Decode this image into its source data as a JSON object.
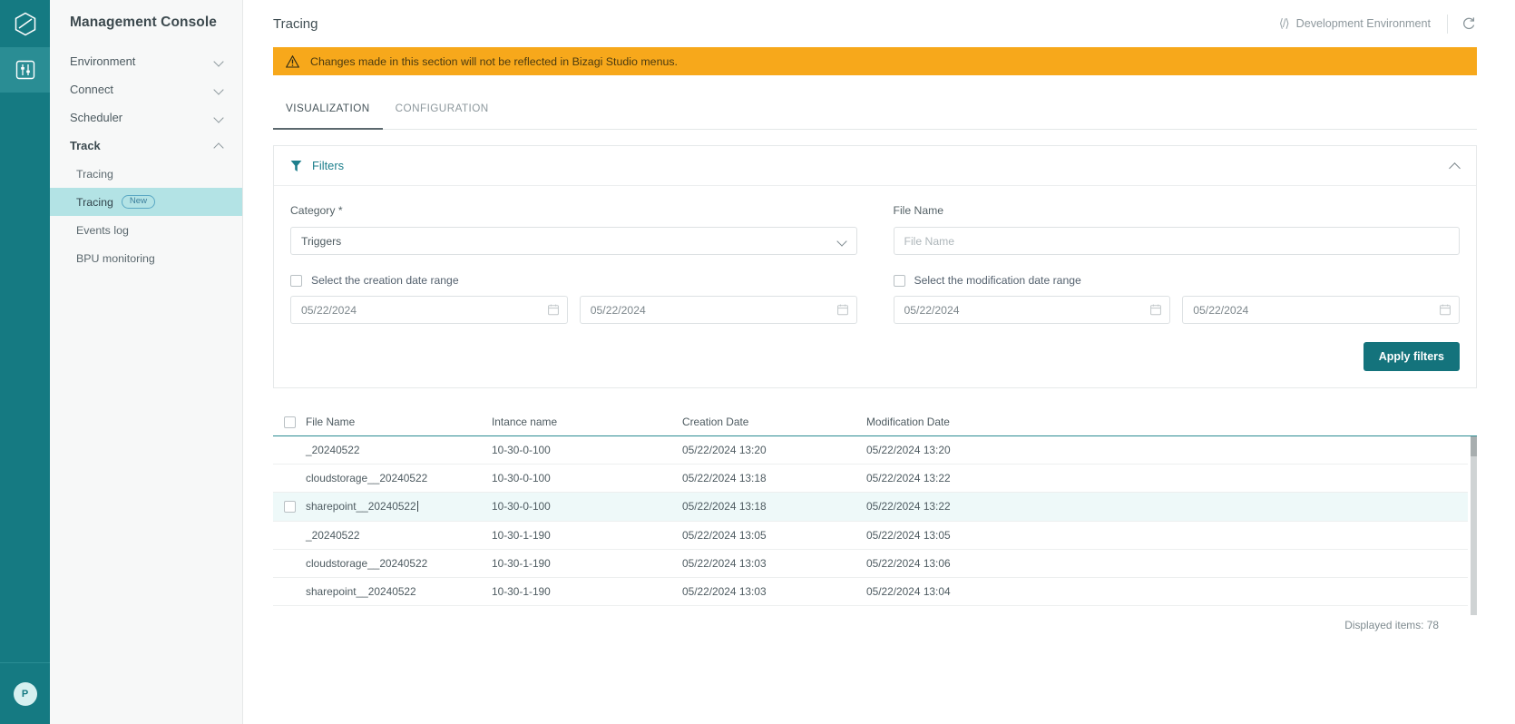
{
  "rail": {
    "logo_icon": "hexagon-logo-icon",
    "items": [
      {
        "icon": "sliders-settings-icon",
        "name": "management-console-icon",
        "active": true
      }
    ],
    "avatar_initial": "P"
  },
  "sidebar": {
    "title": "Management Console",
    "groups": [
      {
        "label": "Environment",
        "state": "collapsed"
      },
      {
        "label": "Connect",
        "state": "collapsed"
      },
      {
        "label": "Scheduler",
        "state": "collapsed"
      },
      {
        "label": "Track",
        "state": "expanded"
      }
    ],
    "track_children": [
      {
        "label": "Tracing",
        "selected": false,
        "badge": ""
      },
      {
        "label": "Tracing",
        "selected": true,
        "badge": "New"
      },
      {
        "label": "Events log",
        "selected": false,
        "badge": ""
      },
      {
        "label": "BPU monitoring",
        "selected": false,
        "badge": ""
      }
    ]
  },
  "header": {
    "title": "Tracing",
    "code_icon": "code-brackets-icon",
    "environment": "Development Environment",
    "refresh_icon": "refresh-icon"
  },
  "banner": {
    "icon": "warning-triangle-icon",
    "text": "Changes made in this section will not be reflected in Bizagi Studio menus.",
    "color": "#f7a81b"
  },
  "tabs": [
    {
      "label": "VISUALIZATION",
      "active": true
    },
    {
      "label": "CONFIGURATION",
      "active": false
    }
  ],
  "filters": {
    "icon": "filter-funnel-icon",
    "title": "Filters",
    "collapse_icon": "chevron-up-icon",
    "category": {
      "label": "Category",
      "required_mark": "*",
      "value": "Triggers",
      "chevron_icon": "chevron-down-icon"
    },
    "file_name": {
      "label": "File Name",
      "value": "",
      "placeholder": "File Name"
    },
    "creation_range": {
      "label": "Select the creation date range",
      "checked": false,
      "from": "05/22/2024",
      "to": "05/22/2024",
      "icon": "calendar-icon"
    },
    "modification_range": {
      "label": "Select the modification date range",
      "checked": false,
      "from": "05/22/2024",
      "to": "05/22/2024",
      "icon": "calendar-icon"
    },
    "apply_label": "Apply filters",
    "apply_color": "#14737c"
  },
  "table": {
    "columns": [
      "File Name",
      "Intance name",
      "Creation Date",
      "Modification Date"
    ],
    "select_all_checked": false,
    "rows": [
      {
        "file": "_20240522",
        "instance": "10-30-0-100",
        "created": "05/22/2024 13:20",
        "modified": "05/22/2024 13:20",
        "hover": false
      },
      {
        "file": "cloudstorage__20240522",
        "instance": "10-30-0-100",
        "created": "05/22/2024 13:18",
        "modified": "05/22/2024 13:22",
        "hover": false
      },
      {
        "file": "sharepoint__20240522",
        "instance": "10-30-0-100",
        "created": "05/22/2024 13:18",
        "modified": "05/22/2024 13:22",
        "hover": true
      },
      {
        "file": "_20240522",
        "instance": "10-30-1-190",
        "created": "05/22/2024 13:05",
        "modified": "05/22/2024 13:05",
        "hover": false
      },
      {
        "file": "cloudstorage__20240522",
        "instance": "10-30-1-190",
        "created": "05/22/2024 13:03",
        "modified": "05/22/2024 13:06",
        "hover": false
      },
      {
        "file": "sharepoint__20240522",
        "instance": "10-30-1-190",
        "created": "05/22/2024 13:03",
        "modified": "05/22/2024 13:04",
        "hover": false
      }
    ],
    "footer": "Displayed items: 78"
  },
  "theme": {
    "teal_dark": "#157a82",
    "teal_accent": "#2b8b92",
    "selected_nav": "#b3e3e5",
    "row_hover": "#eef9f9"
  }
}
